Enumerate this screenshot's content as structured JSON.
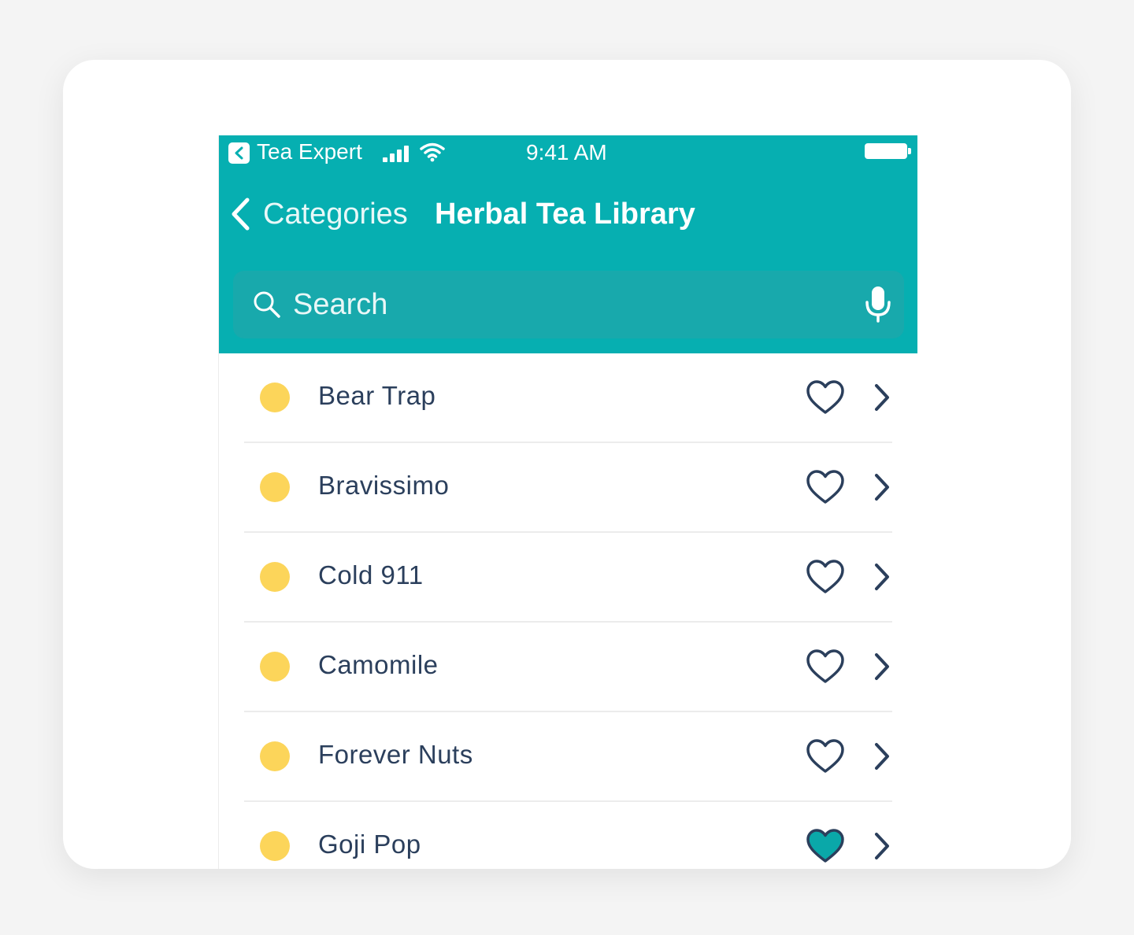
{
  "status_bar": {
    "app_name": "Tea Expert",
    "time": "9:41 AM"
  },
  "nav": {
    "back_label": "Categories",
    "title": "Herbal Tea Library"
  },
  "search": {
    "placeholder": "Search"
  },
  "colors": {
    "header": "#06afb1",
    "dot": "#fcd55a",
    "text": "#2b3f5c",
    "favorite_fill": "#0aa8a9"
  },
  "teas": [
    {
      "name": "Bear Trap",
      "favorite": false
    },
    {
      "name": "Bravissimo",
      "favorite": false
    },
    {
      "name": "Cold 911",
      "favorite": false
    },
    {
      "name": "Camomile",
      "favorite": false
    },
    {
      "name": "Forever Nuts",
      "favorite": false
    },
    {
      "name": "Goji Pop",
      "favorite": true
    }
  ]
}
